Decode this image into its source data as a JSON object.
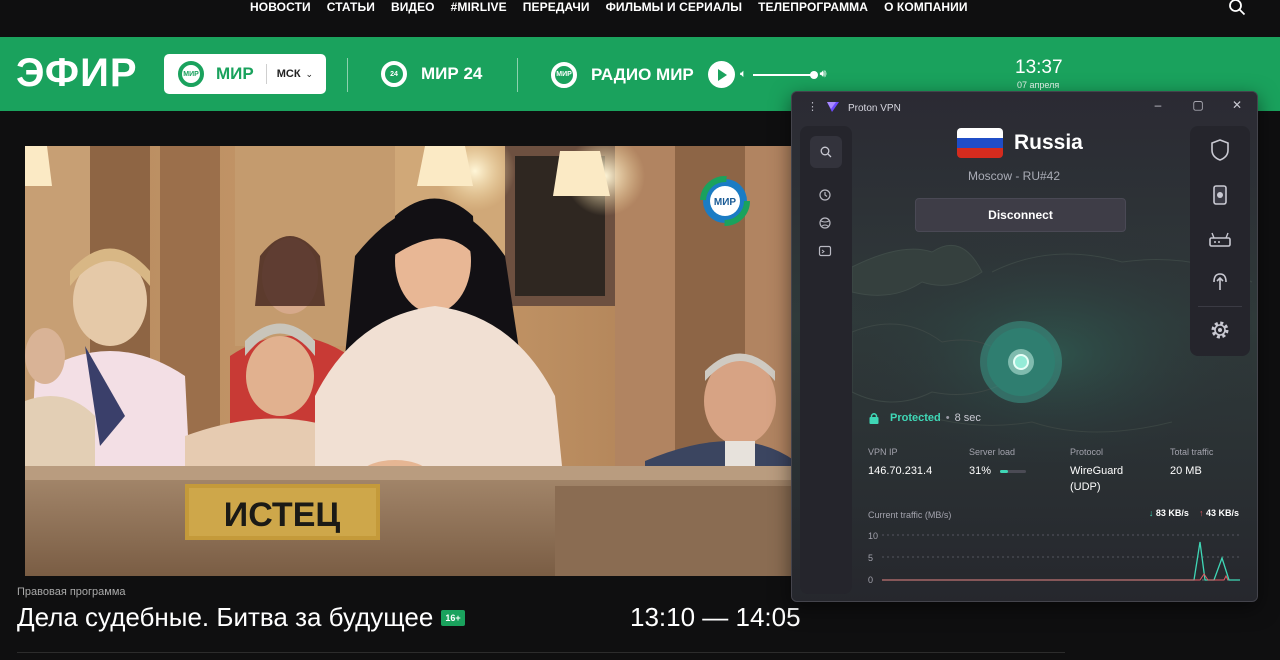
{
  "nav": {
    "links": [
      "НОВОСТИ",
      "СТАТЬИ",
      "ВИДЕО",
      "#MIRLIVE",
      "ПЕРЕДАЧИ",
      "ФИЛЬМЫ И СЕРИАЛЫ",
      "ТЕЛЕПРОГРАММА",
      "О КОМПАНИИ"
    ],
    "search_icon": "search-icon"
  },
  "broadcast": {
    "title": "ЭФИР",
    "channel_main": {
      "logo": "МИР",
      "name": "МИР",
      "region": "МСК"
    },
    "channel_24": {
      "logo": "24",
      "name": "МИР 24"
    },
    "radio": {
      "logo": "МИР",
      "name": "РАДИО МИР"
    },
    "time": "13:37",
    "date": "07 апреля",
    "accent_color": "#1aa25d"
  },
  "video": {
    "channel_bug": "МИР",
    "nameplate": "ИСТЕЦ"
  },
  "program": {
    "type": "Правовая программа",
    "title": "Дела судебные. Битва за будущее",
    "age_rating": "16+",
    "time_range": "13:10 — 14:05"
  },
  "vpn": {
    "app_title": "Proton VPN",
    "country": "Russia",
    "server": "Moscow - RU#42",
    "disconnect_label": "Disconnect",
    "status": "Protected",
    "duration": "8 sec",
    "stats": [
      {
        "label": "VPN IP",
        "value": "146.70.231.4"
      },
      {
        "label": "Server load",
        "value": "31%",
        "load": 0.31
      },
      {
        "label": "Protocol",
        "value": "WireGuard (UDP)"
      },
      {
        "label": "Total traffic",
        "value": "20 MB"
      }
    ],
    "traffic_label": "Current traffic (MB/s)",
    "download": "83 KB/s",
    "upload": "43 KB/s",
    "y_ticks": [
      "10",
      "5",
      "0"
    ],
    "accent_color": "#3fd7b6"
  }
}
